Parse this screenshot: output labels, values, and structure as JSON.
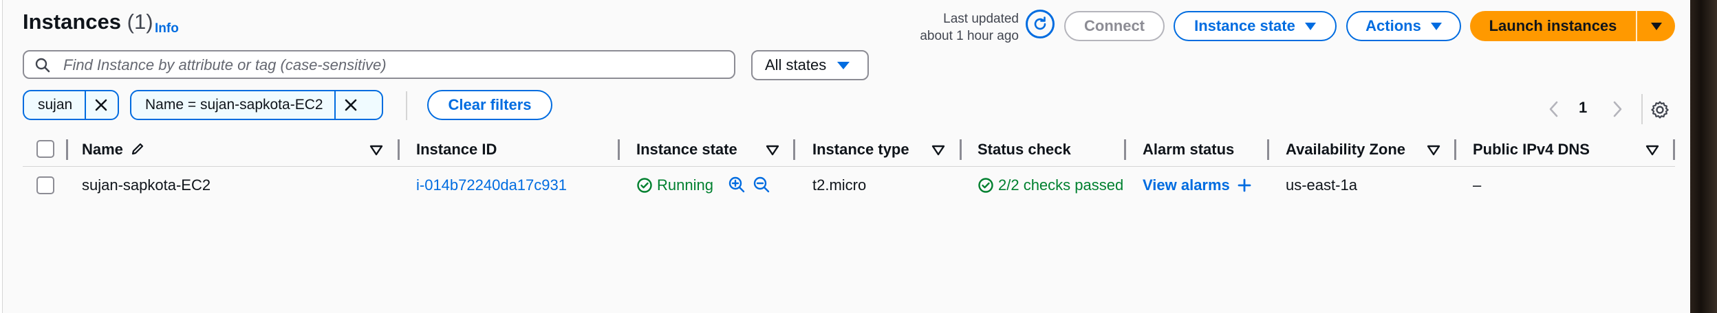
{
  "header": {
    "title": "Instances",
    "count": "(1)",
    "info_label": "Info",
    "last_updated_line1": "Last updated",
    "last_updated_line2": "about 1 hour ago",
    "connect_label": "Connect",
    "instance_state_label": "Instance state",
    "actions_label": "Actions",
    "launch_label": "Launch instances"
  },
  "search": {
    "placeholder": "Find Instance by attribute or tag (case-sensitive)",
    "states_filter": "All states"
  },
  "filters": {
    "tokens": [
      "sujan",
      "Name = sujan-sapkota-EC2"
    ],
    "clear_label": "Clear filters"
  },
  "pagination": {
    "page": "1"
  },
  "table": {
    "columns": [
      "Name",
      "Instance ID",
      "Instance state",
      "Instance type",
      "Status check",
      "Alarm status",
      "Availability Zone",
      "Public IPv4 DNS"
    ],
    "rows": [
      {
        "name": "sujan-sapkota-EC2",
        "instance_id": "i-014b72240da17c931",
        "state": "Running",
        "type": "t2.micro",
        "status_check": "2/2 checks passed",
        "alarm": "View alarms",
        "zone": "us-east-1a",
        "dns": "–"
      }
    ]
  },
  "colors": {
    "accent": "#006ce0",
    "launch": "#ff9900",
    "success": "#00802f"
  },
  "icons": [
    "search-icon",
    "refresh-icon",
    "close-icon",
    "edit-icon",
    "zoom-in-icon",
    "zoom-out-icon",
    "plus-icon",
    "settings-icon",
    "check-circle-icon",
    "chevron-left-icon",
    "chevron-right-icon",
    "sort-icon"
  ]
}
